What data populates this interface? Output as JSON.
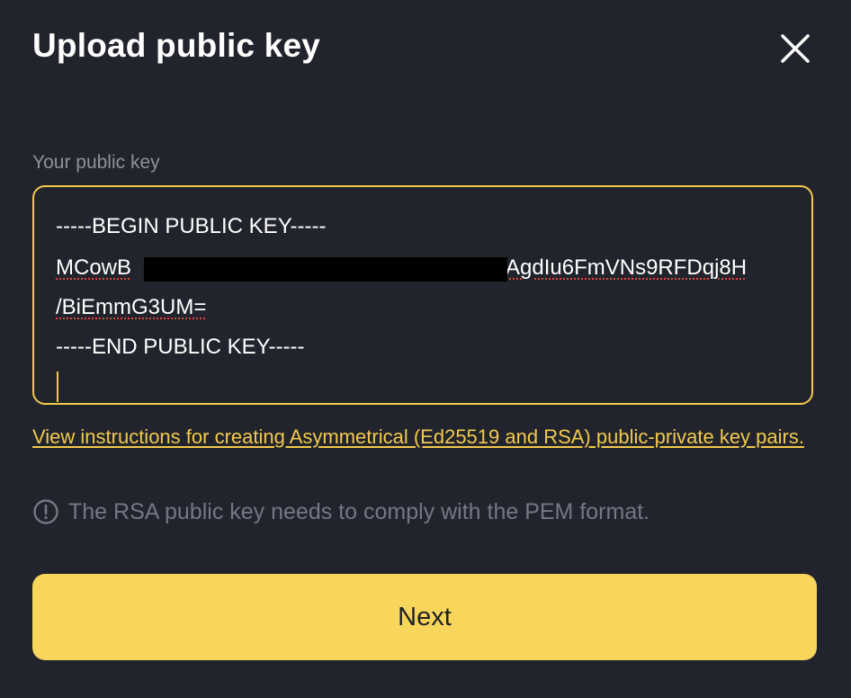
{
  "dialog": {
    "title": "Upload public key",
    "close_icon": "close-icon"
  },
  "key_field": {
    "label": "Your public key",
    "value_lines": [
      "-----BEGIN PUBLIC KEY-----",
      "MCowB",
      "JAgdIu6FmVNs9RFDqj8H",
      "/BiEmmG3UM=",
      "-----END PUBLIC KEY-----"
    ],
    "border_color": "#f2c94c"
  },
  "instructions_link": "View instructions for creating Asymmetrical (Ed25519 and RSA) public-private key pairs.",
  "note": {
    "icon": "info-circle-icon",
    "text": "The RSA public key needs to comply with the PEM format."
  },
  "next_button": {
    "label": "Next",
    "color": "#f8d55b"
  },
  "colors": {
    "background": "#21242c",
    "accent": "#f2c94c"
  }
}
